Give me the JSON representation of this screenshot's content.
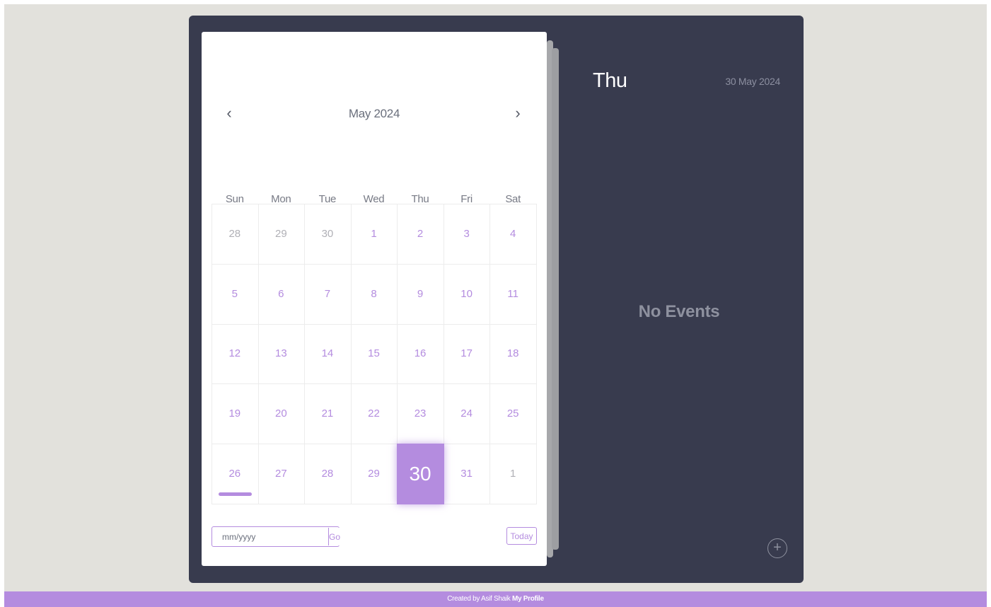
{
  "calendar": {
    "month_title": "May 2024",
    "prev_icon": "‹",
    "next_icon": "›",
    "weekdays": [
      "Sun",
      "Mon",
      "Tue",
      "Wed",
      "Thu",
      "Fri",
      "Sat"
    ],
    "weeks": [
      [
        {
          "day": "28",
          "current": false
        },
        {
          "day": "29",
          "current": false
        },
        {
          "day": "30",
          "current": false
        },
        {
          "day": "1",
          "current": true
        },
        {
          "day": "2",
          "current": true
        },
        {
          "day": "3",
          "current": true
        },
        {
          "day": "4",
          "current": true
        }
      ],
      [
        {
          "day": "5",
          "current": true
        },
        {
          "day": "6",
          "current": true
        },
        {
          "day": "7",
          "current": true
        },
        {
          "day": "8",
          "current": true
        },
        {
          "day": "9",
          "current": true
        },
        {
          "day": "10",
          "current": true
        },
        {
          "day": "11",
          "current": true
        }
      ],
      [
        {
          "day": "12",
          "current": true
        },
        {
          "day": "13",
          "current": true
        },
        {
          "day": "14",
          "current": true
        },
        {
          "day": "15",
          "current": true
        },
        {
          "day": "16",
          "current": true
        },
        {
          "day": "17",
          "current": true
        },
        {
          "day": "18",
          "current": true
        }
      ],
      [
        {
          "day": "19",
          "current": true
        },
        {
          "day": "20",
          "current": true
        },
        {
          "day": "21",
          "current": true
        },
        {
          "day": "22",
          "current": true
        },
        {
          "day": "23",
          "current": true
        },
        {
          "day": "24",
          "current": true
        },
        {
          "day": "25",
          "current": true
        }
      ],
      [
        {
          "day": "26",
          "current": true
        },
        {
          "day": "27",
          "current": true
        },
        {
          "day": "28",
          "current": true
        },
        {
          "day": "29",
          "current": true
        },
        {
          "day": "30",
          "current": true,
          "selected": true
        },
        {
          "day": "31",
          "current": true
        },
        {
          "day": "1",
          "current": false
        }
      ]
    ],
    "date_input_placeholder": "mm/yyyy",
    "go_label": "Go",
    "today_label": "Today"
  },
  "events": {
    "day_name": "Thu",
    "full_date": "30 May 2024",
    "empty_message": "No Events",
    "add_icon": "+"
  },
  "footer": {
    "credit_text": "Created by Asif Shaik",
    "profile_link": "My Profile"
  },
  "colors": {
    "accent": "#b48cdf",
    "panel": "#383b4e",
    "page_bg": "#e2e1dc"
  }
}
